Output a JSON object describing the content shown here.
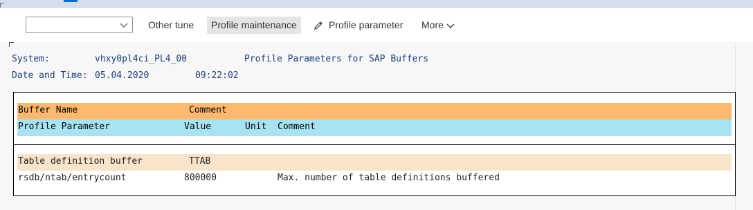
{
  "toolbar": {
    "select_value": "",
    "other_tune_label": "Other tune",
    "profile_maintenance_label": "Profile maintenance",
    "profile_parameter_label": "Profile parameter",
    "more_label": "More"
  },
  "header": {
    "system_label": "System:",
    "system_value": "vhxy0pl4ci_PL4_00",
    "title": "Profile Parameters for SAP Buffers",
    "datetime_label": "Date and Time:",
    "date_value": "05.04.2020",
    "time_value": "09:22:02"
  },
  "table": {
    "header_row1": {
      "col1": "Buffer Name",
      "col2": "Comment"
    },
    "header_row2": {
      "col1": "Profile Parameter",
      "col2": "Value",
      "col3": "Unit",
      "col4": "Comment"
    },
    "buffer_row": {
      "name": "Table definition buffer",
      "comment": "TTAB"
    },
    "param_row": {
      "parameter": "rsdb/ntab/entrycount",
      "value": "800000",
      "unit": "",
      "comment": "Max. number of table definitions buffered"
    }
  },
  "colors": {
    "header_orange": "#ffb96e",
    "header_cyan": "#a7e3f2",
    "group_beige": "#f7e4cb",
    "text_blue": "#1c3f7a"
  }
}
